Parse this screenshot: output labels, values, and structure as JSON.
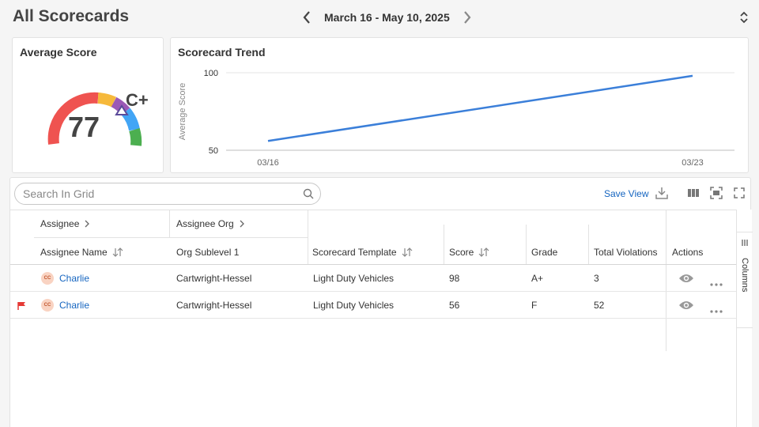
{
  "header": {
    "title": "All Scorecards",
    "date_range": "March 16 - May 10, 2025"
  },
  "average_score": {
    "title": "Average Score",
    "score": "77",
    "grade": "C+"
  },
  "trend": {
    "title": "Scorecard Trend",
    "chart_data": {
      "type": "line",
      "ylabel": "Average Score",
      "xlabel": "",
      "x": [
        "03/16",
        "03/23"
      ],
      "series": [
        {
          "values": [
            56,
            98
          ]
        }
      ],
      "ylim": [
        50,
        100
      ],
      "yticks": [
        "100",
        "50"
      ],
      "grid": true
    },
    "colors": {
      "line": "#3b7fd9"
    }
  },
  "grid": {
    "search_placeholder": "Search In Grid",
    "save_view": "Save View",
    "group_headers": {
      "assignee": "Assignee",
      "assignee_org": "Assignee Org"
    },
    "columns": {
      "assignee_name": "Assignee Name",
      "org_sublevel": "Org Sublevel 1",
      "template": "Scorecard Template",
      "score": "Score",
      "grade": "Grade",
      "violations": "Total Violations",
      "actions": "Actions"
    },
    "rows": [
      {
        "initials": "CC",
        "name": "Charlie",
        "org": "Cartwright-Hessel",
        "template": "Light Duty Vehicles",
        "score": "98",
        "grade": "A+",
        "violations": "3",
        "flagged": false
      },
      {
        "initials": "CC",
        "name": "Charlie",
        "org": "Cartwright-Hessel",
        "template": "Light Duty Vehicles",
        "score": "56",
        "grade": "F",
        "violations": "52",
        "flagged": true
      }
    ],
    "side_panel": "Columns"
  },
  "colors": {
    "accent": "#1565c0",
    "gauge": [
      "#ef5350",
      "#f6b93b",
      "#9b59b6",
      "#42a5f5",
      "#4caf50"
    ],
    "flag": "#e53935"
  }
}
